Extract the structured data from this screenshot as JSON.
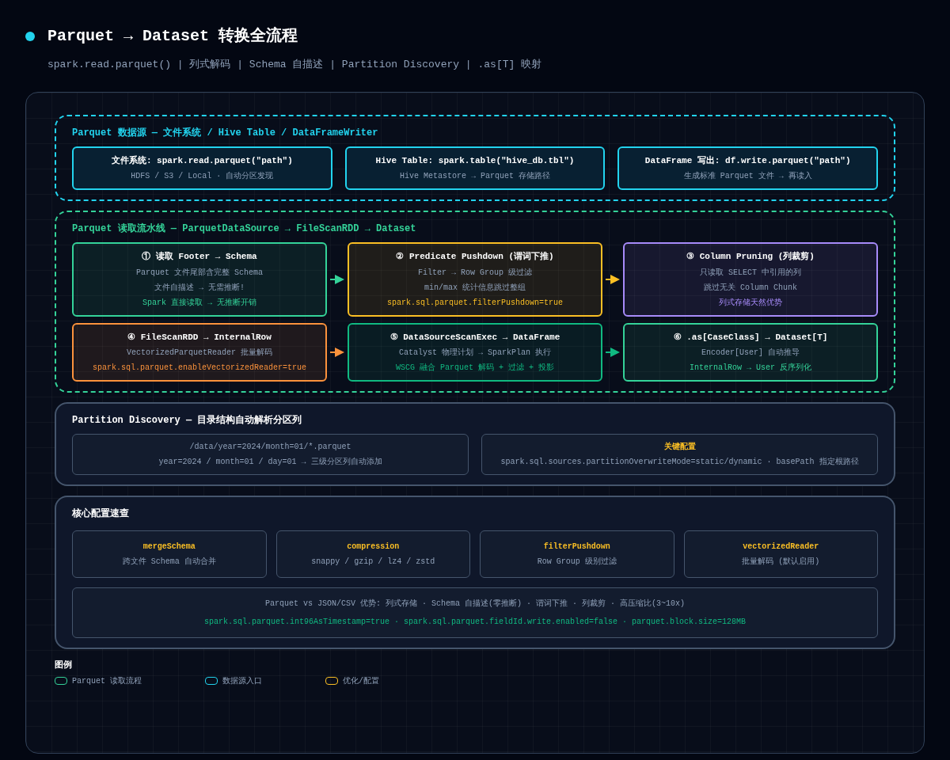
{
  "header": {
    "title": "Parquet → Dataset 转换全流程",
    "subtitle": "spark.read.parquet() | 列式解码 | Schema 自描述 | Partition Discovery | .as[T] 映射"
  },
  "source_group": {
    "title": "Parquet 数据源 — 文件系统 / Hive Table / DataFrameWriter",
    "cards": [
      {
        "title": "文件系统: spark.read.parquet(\"path\")",
        "subtitle": "HDFS / S3 / Local · 自动分区发现"
      },
      {
        "title": "Hive Table: spark.table(\"hive_db.tbl\")",
        "subtitle": "Hive Metastore → Parquet 存储路径"
      },
      {
        "title": "DataFrame 写出: df.write.parquet(\"path\")",
        "subtitle": "生成标准 Parquet 文件 → 再读入"
      }
    ]
  },
  "pipeline": {
    "title": "Parquet 读取流水线 — ParquetDataSource → FileScanRDD → Dataset",
    "steps": [
      {
        "title": "① 读取 Footer → Schema",
        "lines": [
          "Parquet 文件尾部含完整 Schema",
          "文件自描述 → 无需推断!"
        ],
        "note": "Spark 直接读取 → 无推断开销",
        "color": "#34d399"
      },
      {
        "title": "② Predicate Pushdown (谓词下推)",
        "lines": [
          "Filter → Row Group 级过滤",
          "min/max 统计信息跳过整组"
        ],
        "note": "spark.sql.parquet.filterPushdown=true",
        "color": "#fbbf24"
      },
      {
        "title": "③ Column Pruning (列裁剪)",
        "lines": [
          "只读取 SELECT 中引用的列",
          "跳过无关 Column Chunk"
        ],
        "note": "列式存储天然优势",
        "color": "#a78bfa"
      },
      {
        "title": "④ FileScanRDD → InternalRow",
        "lines": [
          "VectorizedParquetReader 批量解码"
        ],
        "note": "spark.sql.parquet.enableVectorizedReader=true",
        "color": "#fb923c"
      },
      {
        "title": "⑤ DataSourceScanExec → DataFrame",
        "lines": [
          "Catalyst 物理计划 → SparkPlan 执行"
        ],
        "note": "WSCG 融合 Parquet 解码 + 过滤 + 投影",
        "color": "#10b981"
      },
      {
        "title": "⑥ .as[CaseClass] → Dataset[T]",
        "lines": [
          "Encoder[User] 自动推导"
        ],
        "note": "InternalRow → User 反序列化",
        "color": "#34d399"
      }
    ]
  },
  "partition": {
    "title": "Partition Discovery — 目录结构自动解析分区列",
    "cards": [
      {
        "kind": "path",
        "lines": [
          "/data/year=2024/month=01/*.parquet",
          "year=2024 / month=01 / day=01 → 三级分区列自动添加"
        ]
      },
      {
        "kind": "config",
        "title": "关键配置",
        "text": "spark.sql.sources.partitionOverwriteMode=static/dynamic · basePath 指定根路径"
      }
    ]
  },
  "config": {
    "title": "核心配置速查",
    "items": [
      {
        "name": "mergeSchema",
        "desc": "跨文件 Schema 自动合并"
      },
      {
        "name": "compression",
        "desc": "snappy / gzip / lz4 / zstd"
      },
      {
        "name": "filterPushdown",
        "desc": "Row Group 级别过滤"
      },
      {
        "name": "vectorizedReader",
        "desc": "批量解码 (默认启用)"
      }
    ],
    "summary": {
      "text": "Parquet vs JSON/CSV 优势: 列式存储 · Schema 自描述(零推断) · 谓词下推 · 列裁剪 · 高压缩比(3~10x)",
      "settings": "spark.sql.parquet.int96AsTimestamp=true · spark.sql.parquet.fieldId.write.enabled=false · parquet.block.size=128MB"
    }
  },
  "legend": {
    "title": "图例",
    "items": [
      {
        "label": "Parquet 读取流程",
        "color": "#34d399"
      },
      {
        "label": "数据源入口",
        "color": "#22d3ee"
      },
      {
        "label": "优化/配置",
        "color": "#fbbf24"
      }
    ]
  }
}
